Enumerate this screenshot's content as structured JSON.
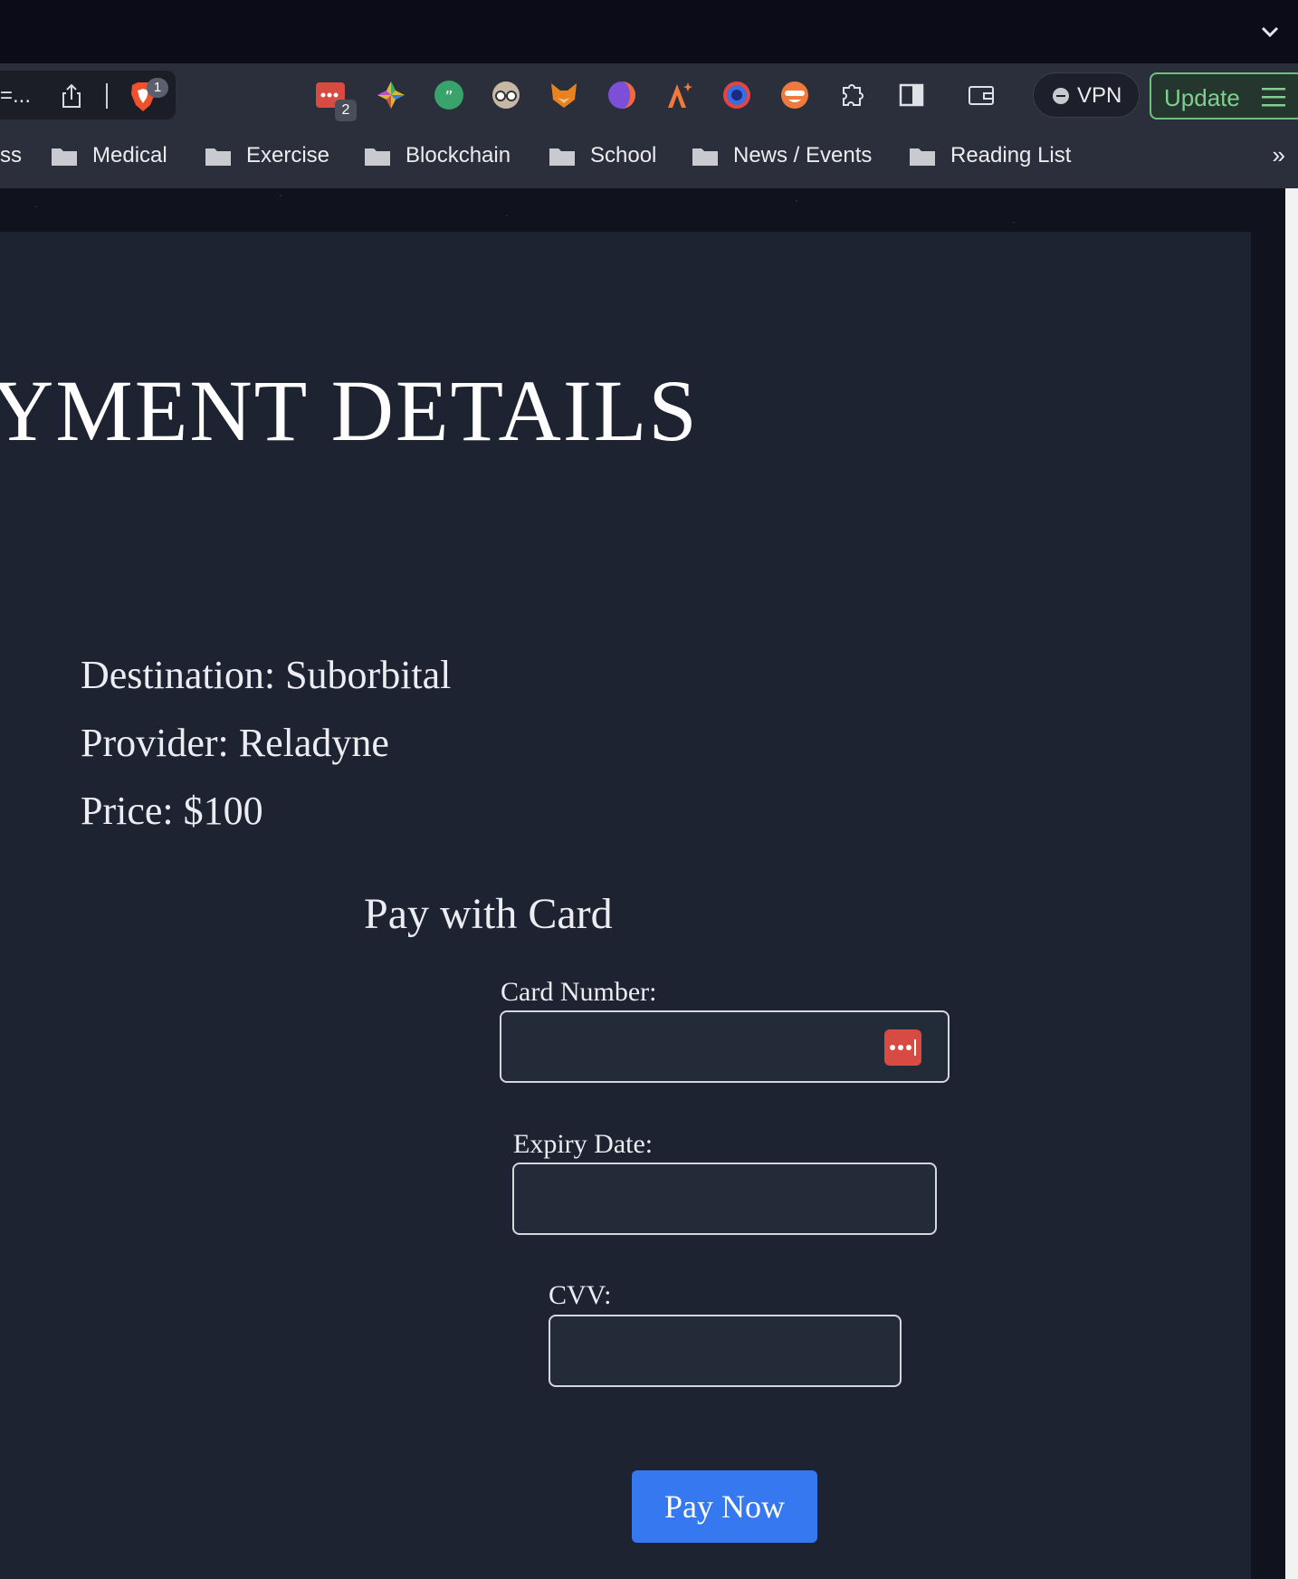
{
  "browser": {
    "url_partial": "=...",
    "brave_badge": "1",
    "extension_badge": "2",
    "vpn_label": "VPN",
    "update_label": "Update",
    "extensions": [
      "password-manager-icon",
      "color-picker-icon",
      "quote-icon",
      "reader-glasses-icon",
      "fox-wallet-icon",
      "half-moon-icon",
      "sparkle-arrow-icon",
      "circle-orb-icon",
      "masked-face-icon",
      "puzzle-icon",
      "sidebar-icon",
      "wallet-icon"
    ]
  },
  "bookmarks": [
    {
      "label": "ss"
    },
    {
      "label": "Medical"
    },
    {
      "label": "Exercise"
    },
    {
      "label": "Blockchain"
    },
    {
      "label": "School"
    },
    {
      "label": "News / Events"
    },
    {
      "label": "Reading List"
    }
  ],
  "bookmarks_more": "»",
  "page": {
    "heading": "YMENT DETAILS",
    "destination": "Destination: Suborbital",
    "provider": "Provider: Reladyne",
    "price": "Price: $100",
    "pay_with_card": "Pay with Card",
    "card_number_label": "Card Number:",
    "expiry_label": "Expiry Date:",
    "cvv_label": "CVV:",
    "pay_button": "Pay Now"
  },
  "colors": {
    "panel": "#1e2332",
    "accent_button": "#3678f0",
    "update_green": "#7fd08f"
  }
}
